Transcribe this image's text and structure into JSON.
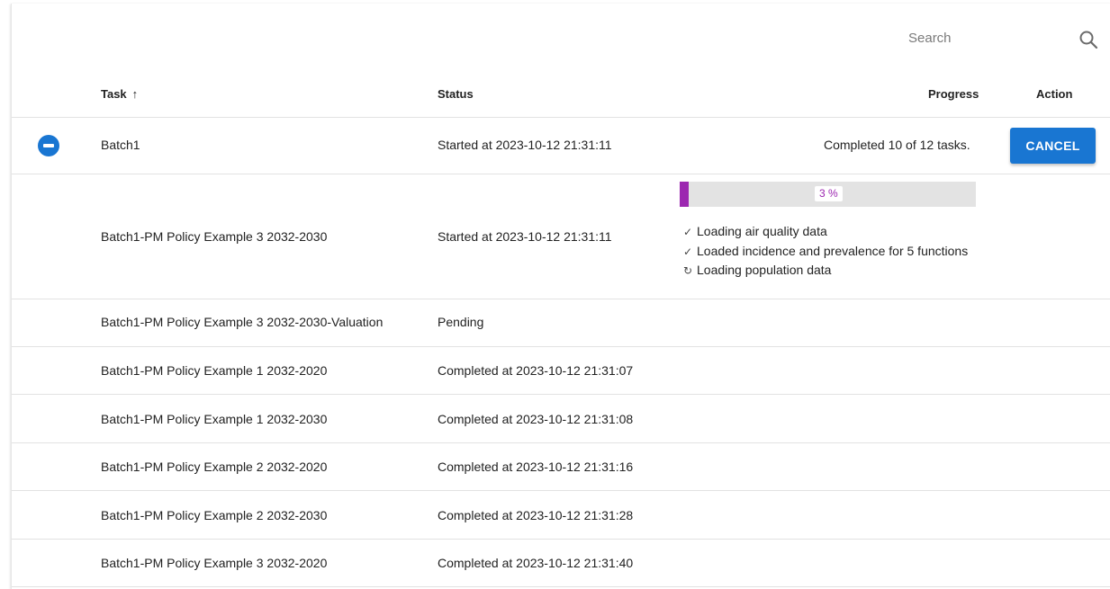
{
  "search": {
    "placeholder": "Search",
    "icon": "search-icon"
  },
  "table": {
    "columns": {
      "task": "Task",
      "task_sort": "↑",
      "status": "Status",
      "progress": "Progress",
      "action": "Action"
    },
    "batch": {
      "task": "Batch1",
      "status": "Started at 2023-10-12 21:31:11",
      "progress_text": "Completed 10 of 12 tasks.",
      "action_label": "CANCEL",
      "expanded": true,
      "toggle_icon": "minus-circle-icon"
    },
    "rows": [
      {
        "task": "Batch1-PM Policy Example 3 2032-2030",
        "status": "Started at 2023-10-12 21:31:11",
        "progress_percent": 3,
        "progress_label": "3 %",
        "steps": [
          {
            "icon": "check-icon",
            "glyph": "✓",
            "text": "Loading air quality data"
          },
          {
            "icon": "check-icon",
            "glyph": "✓",
            "text": "Loaded incidence and prevalence for 5 functions"
          },
          {
            "icon": "sync-icon",
            "glyph": "↻",
            "text": "Loading population data"
          }
        ]
      },
      {
        "task": "Batch1-PM Policy Example 3 2032-2030-Valuation",
        "status": "Pending"
      },
      {
        "task": "Batch1-PM Policy Example 1 2032-2020",
        "status": "Completed at 2023-10-12 21:31:07"
      },
      {
        "task": "Batch1-PM Policy Example 1 2032-2030",
        "status": "Completed at 2023-10-12 21:31:08"
      },
      {
        "task": "Batch1-PM Policy Example 2 2032-2020",
        "status": "Completed at 2023-10-12 21:31:16"
      },
      {
        "task": "Batch1-PM Policy Example 2 2032-2030",
        "status": "Completed at 2023-10-12 21:31:28"
      },
      {
        "task": "Batch1-PM Policy Example 3 2032-2020",
        "status": "Completed at 2023-10-12 21:31:40"
      }
    ]
  },
  "colors": {
    "primary": "#1976d2",
    "progress_fill": "#9c27b0",
    "progress_track": "#e3e3e3",
    "divider": "#e2e2e2"
  }
}
